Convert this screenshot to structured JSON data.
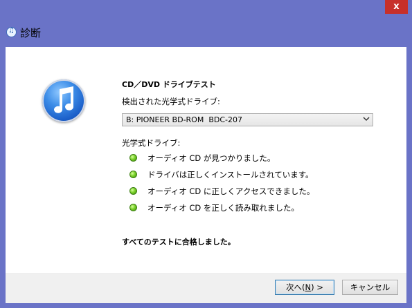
{
  "window": {
    "title": "診断",
    "close_glyph": "x"
  },
  "content": {
    "heading": "CD／DVD ドライブテスト",
    "detected_label": "検出された光学式ドライブ:",
    "drive_select": {
      "value": "B: PIONEER BD-ROM  BDC-207"
    },
    "optical_label": "光学式ドライブ:",
    "results": [
      "オーディオ CD が見つかりました。",
      "ドライバは正しくインストールされています。",
      "オーディオ CD に正しくアクセスできました。",
      "オーディオ CD を正しく読み取れました。"
    ],
    "summary": "すべてのテストに合格しました。"
  },
  "buttons": {
    "next_prefix": "次へ(",
    "next_key": "N",
    "next_suffix": ") >",
    "cancel": "キャンセル"
  },
  "colors": {
    "titlebar": "#6a73c7",
    "close": "#c7302a",
    "status_ok": "#7ad12a"
  },
  "icons": {
    "app": "itunes-icon",
    "result": "green-status-icon"
  }
}
